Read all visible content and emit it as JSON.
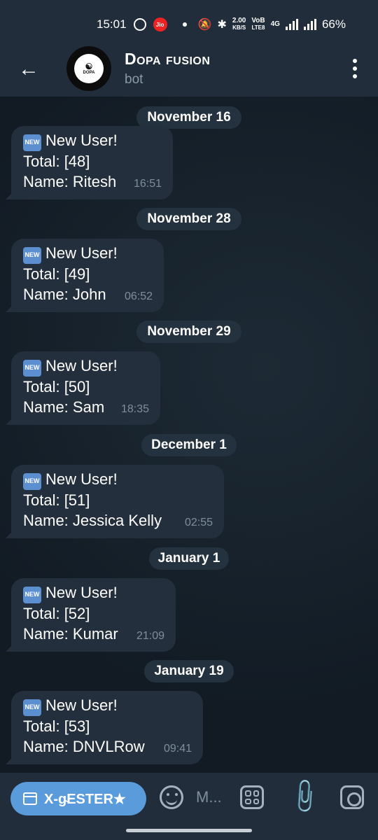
{
  "status_bar": {
    "time": "15:01",
    "jio_label": "Jio",
    "speed_top": "2.00",
    "speed_bottom": "KB/S",
    "volte_top": "VoB",
    "volte_bottom": "LTE8",
    "network": "4G",
    "battery": "66%"
  },
  "header": {
    "title": "Dopa fusion",
    "subtitle": "bot"
  },
  "messages": [
    {
      "date": "November 16",
      "line1": "New User!",
      "line2": "Total: [48]",
      "line3": "Name: Ritesh",
      "time": "16:51"
    },
    {
      "date": "November 28",
      "line1": "New User!",
      "line2": "Total: [49]",
      "line3": "Name: John",
      "time": "06:52"
    },
    {
      "date": "November 29",
      "line1": "New User!",
      "line2": "Total: [50]",
      "line3": "Name: Sam",
      "time": "18:35"
    },
    {
      "date": "December 1",
      "line1": "New User!",
      "line2": "Total: [51]",
      "line3": "Name: Jessica Kelly",
      "time": "02:55"
    },
    {
      "date": "January 1",
      "line1": "New User!",
      "line2": "Total: [52]",
      "line3": "Name: Kumar",
      "time": "21:09"
    },
    {
      "date": "January 19",
      "line1": "New User!",
      "line2": "Total: [53]",
      "line3": "Name: DNVLRow",
      "time": "09:41"
    }
  ],
  "new_badge": "NEW",
  "input_bar": {
    "menu_button_label": "X-g̴ESTER★",
    "placeholder": "M..."
  },
  "colors": {
    "background": "#16212c",
    "bar": "#212d3b",
    "bubble": "#242f3d",
    "accent": "#5a9bdc"
  }
}
